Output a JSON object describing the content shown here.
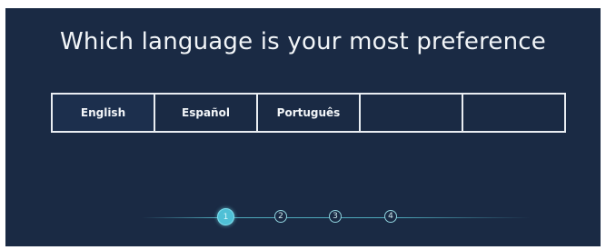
{
  "title": "Which language is your most preference",
  "languages": [
    {
      "label": "English",
      "selected": true
    },
    {
      "label": "Español",
      "selected": false
    },
    {
      "label": "Português",
      "selected": false
    },
    {
      "label": "",
      "selected": false
    },
    {
      "label": "",
      "selected": false
    }
  ],
  "steps": [
    {
      "label": "1",
      "active": true
    },
    {
      "label": "2",
      "active": false
    },
    {
      "label": "3",
      "active": false
    },
    {
      "label": "4",
      "active": false
    }
  ],
  "colors": {
    "background": "#1a2a44",
    "text": "#f2f5f8",
    "accent": "#4fc0d6",
    "line": "#4ea8ba"
  }
}
